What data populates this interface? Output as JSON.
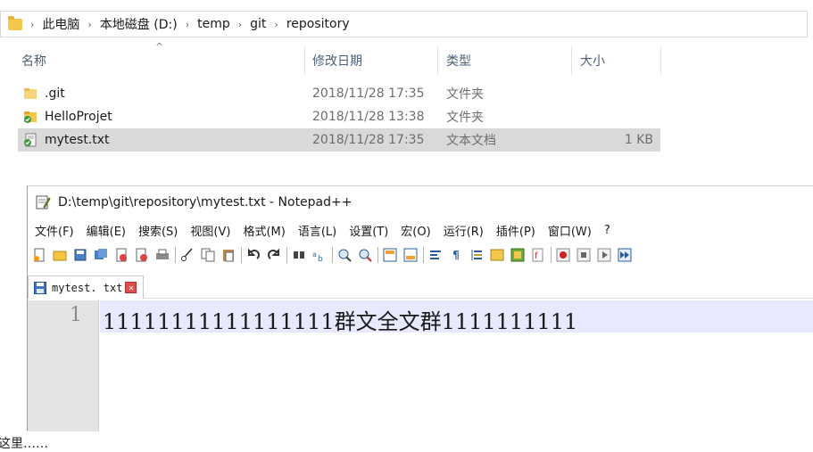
{
  "explorer": {
    "breadcrumb": [
      "此电脑",
      "本地磁盘 (D:)",
      "temp",
      "git",
      "repository"
    ],
    "columns": {
      "name": "名称",
      "date": "修改日期",
      "type": "类型",
      "size": "大小"
    },
    "files": [
      {
        "name": ".git",
        "date": "2018/11/28 17:35",
        "type": "文件夹",
        "size": "",
        "icon": "folder-icon"
      },
      {
        "name": "HelloProjet",
        "date": "2018/11/28 13:38",
        "type": "文件夹",
        "size": "",
        "icon": "git-folder-icon"
      },
      {
        "name": "mytest.txt",
        "date": "2018/11/28 17:35",
        "type": "文本文档",
        "size": "1 KB",
        "icon": "git-file-icon"
      }
    ]
  },
  "notepad": {
    "title": "D:\\temp\\git\\repository\\mytest.txt - Notepad++",
    "menu": [
      "文件(F)",
      "编辑(E)",
      "搜索(S)",
      "视图(V)",
      "格式(M)",
      "语言(L)",
      "设置(T)",
      "宏(O)",
      "运行(R)",
      "插件(P)",
      "窗口(W)",
      "?"
    ],
    "tab_label": "mytest. txt",
    "line_number": "1",
    "line_text": "11111111111111111群文全文群1111111111"
  },
  "bottom_text": "这里……"
}
